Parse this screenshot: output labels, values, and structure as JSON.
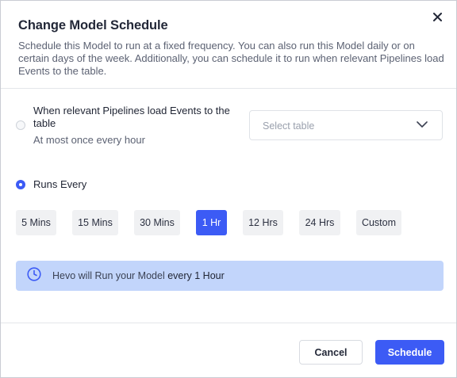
{
  "dialog": {
    "title": "Change Model Schedule",
    "subtitle": "Schedule this Model to run at a fixed frequency. You can also run this Model daily or on certain days of the week. Additionally, you can schedule it to run when relevant Pipelines load Events to the table.",
    "close_icon": "close-icon"
  },
  "option_pipelines": {
    "label": "When relevant Pipelines load Events to the table",
    "sublabel": "At most once every hour",
    "selected": false,
    "table_select": {
      "placeholder": "Select table",
      "icon": "chevron-down-icon"
    }
  },
  "option_runs_every": {
    "label": "Runs Every",
    "selected": true,
    "frequencies": [
      "5 Mins",
      "15 Mins",
      "30 Mins",
      "1 Hr",
      "12 Hrs",
      "24 Hrs",
      "Custom"
    ],
    "active_frequency": "1 Hr"
  },
  "info": {
    "icon": "clock-icon",
    "text": "Hevo will Run your Model ",
    "highlight": "every 1 Hour"
  },
  "footer": {
    "cancel_label": "Cancel",
    "primary_label": "Schedule"
  },
  "colors": {
    "accent": "#3c5bf5",
    "info_bg": "#c2d5fb"
  }
}
